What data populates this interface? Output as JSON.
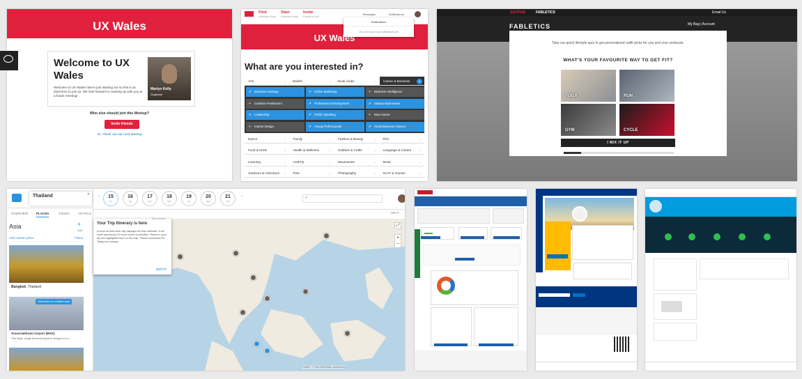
{
  "ux_wales": {
    "banner_title": "UX Wales",
    "welcome_title": "Welcome to UX Wales",
    "welcome_text": "Welcome to UX Wales! We're just starting out so this is an ideal time to join us. We look forward to meeting up with you at a future meeting!",
    "organizer_name": "Martyn Kelly",
    "organizer_role": "Organizer",
    "who_else": "Who else should join this Meetup?",
    "invite_button": "Invite friends",
    "next_link": "Or, check out our next Meetup"
  },
  "interests": {
    "nav": [
      {
        "title": "Find",
        "sub": "a Meetup Group"
      },
      {
        "title": "Start",
        "sub": "a Meetup Group"
      },
      {
        "title": "Invite",
        "sub": "Friends to Join"
      }
    ],
    "messages": "Messages",
    "notifications": "Notifications",
    "notif_title": "Notifications",
    "notif_empty": "You don't have any notifications yet",
    "banner_title": "UX Wales",
    "question": "What are you interested in?",
    "categories_top": [
      "Arts",
      "Beliefs",
      "Book Clubs",
      "Career & Business"
    ],
    "career_count": "8",
    "sub_items": [
      {
        "label": "Business Strategy",
        "on": true
      },
      {
        "label": "Online Marketing",
        "on": true
      },
      {
        "label": "Business Intelligence",
        "on": false
      },
      {
        "label": "Creative Freelancers",
        "on": false
      },
      {
        "label": "Professional Development",
        "on": true
      },
      {
        "label": "Startup Businesses",
        "on": true
      },
      {
        "label": "Leadership",
        "on": true
      },
      {
        "label": "Public Speaking",
        "on": true
      },
      {
        "label": "New Career",
        "on": false
      },
      {
        "label": "Interior Design",
        "on": false
      },
      {
        "label": "Young Professionals",
        "on": true
      },
      {
        "label": "Small Business Owners",
        "on": true
      }
    ],
    "categories_rest": [
      [
        "Dance",
        "Family",
        "Fashion & Beauty",
        "Film"
      ],
      [
        "Food & Drink",
        "Health & Wellness",
        "Hobbies & Crafts",
        "Language & Culture"
      ],
      [
        "Learning",
        "LGBTQ",
        "Movements",
        "Music"
      ],
      [
        "Outdoors & Adventure",
        "Pets",
        "Photography",
        "Sci-Fi & Games"
      ]
    ]
  },
  "fabletics": {
    "topbar_left": "JUSTFAB",
    "topbar_left2": "FABLETICS",
    "topbar_right": "Email Us",
    "brand": "FABLETICS",
    "account": "My Bag  |  Account",
    "subtitle": "Take our quick lifestyle quiz to get personalized outfit picks for you and your workouts.",
    "question": "WHAT'S YOUR FAVOURITE WAY TO GET FIT?",
    "options": [
      "YOGA",
      "RUN",
      "GYM",
      "CYCLE"
    ],
    "mix_button": "I MIX IT UP",
    "progress": 0.16
  },
  "trip": {
    "country": "Thailand",
    "tabs": [
      "OVERVIEW",
      "PLACES",
      "TOURS",
      "HOTELS"
    ],
    "region": "Asia",
    "add_label": "Add",
    "add_place": "Add custom place",
    "filters": "Filters",
    "places": [
      {
        "name": "Bangkok",
        "country": "Thailand"
      },
      {
        "name": "Suvarnabhumi Airport (BKK)",
        "desc": "This large, single-terminal airport is designed in a ..."
      }
    ],
    "scheduled_badge": "Scheduled on multiple days",
    "days": [
      {
        "num": "15",
        "dow": "Fri"
      },
      {
        "num": "16",
        "dow": "Sat"
      },
      {
        "num": "17",
        "dow": "Sun"
      },
      {
        "num": "18",
        "dow": "Mon"
      },
      {
        "num": "19",
        "dow": "Tue"
      },
      {
        "num": "20",
        "dow": "Wed"
      },
      {
        "num": "21",
        "dow": "Thu"
      }
    ],
    "help": "HELP",
    "popup_title": "Your Trip Itinerary is here",
    "popup_skip": "Skip tutorial",
    "popup_text": "A circle around each day displays the time estimate. A full circle represents 12 hours worth of activities. Places in your trip are highlighted blue on the map. Places scheduled for Today turn orange.",
    "popup_ok": "GOT IT",
    "attribution": "Leaflet | © OpenStreetMap contributors"
  },
  "colors": {
    "meetup_red": "#e0213d",
    "meetup_blue": "#2b93e0",
    "paypal_blue": "#009cde",
    "booking_blue": "#003580"
  }
}
